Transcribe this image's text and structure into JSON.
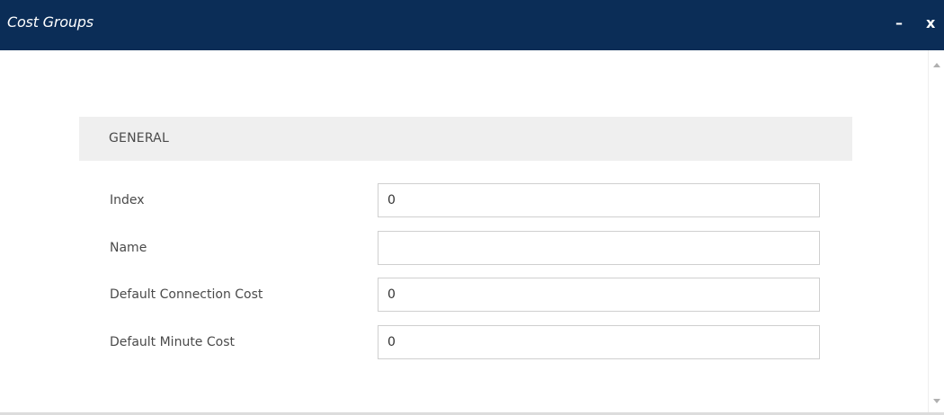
{
  "window": {
    "title": "Cost Groups",
    "minimize_label": "–",
    "close_label": "x"
  },
  "section": {
    "title": "GENERAL"
  },
  "fields": [
    {
      "label": "Index",
      "value": "0"
    },
    {
      "label": "Name",
      "value": ""
    },
    {
      "label": "Default Connection Cost",
      "value": "0"
    },
    {
      "label": "Default Minute Cost",
      "value": "0"
    }
  ],
  "colors": {
    "titlebar": "#0b2d57",
    "section_header_bg": "#efefef",
    "label_text": "#4a4a4a",
    "field_border": "#cfcfcf"
  },
  "icons": {
    "scroll_up": "chevron-up-icon",
    "scroll_down": "chevron-down-icon"
  }
}
